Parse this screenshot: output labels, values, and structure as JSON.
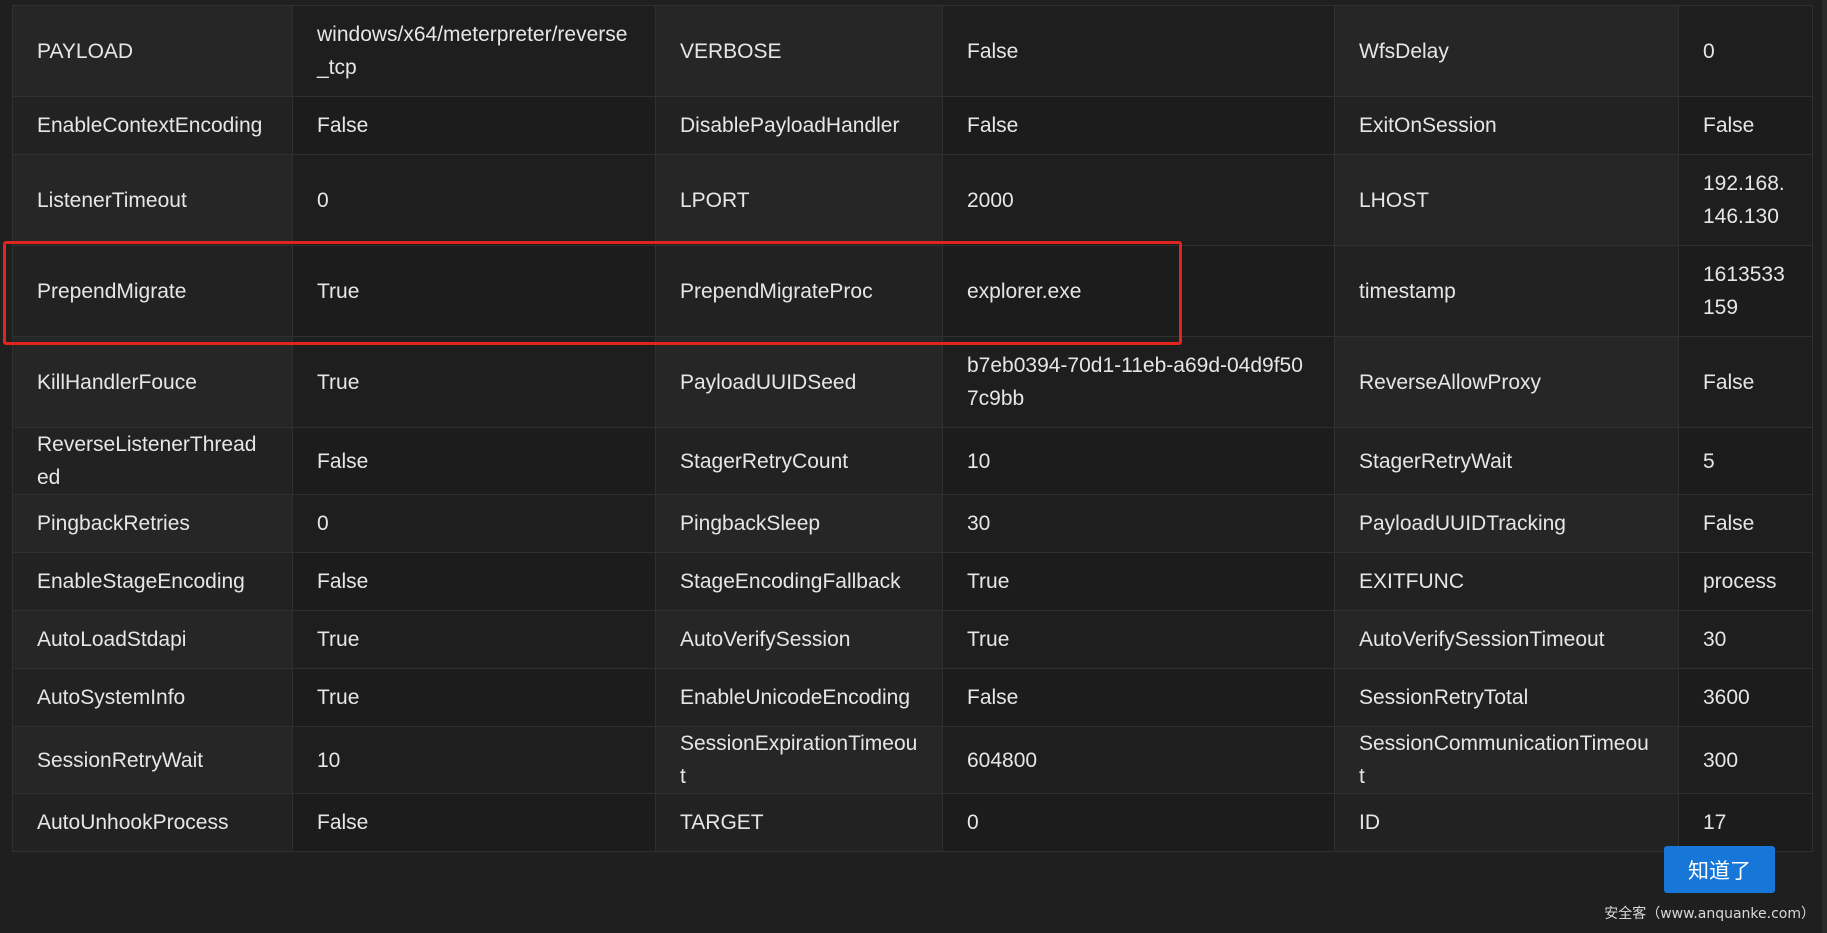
{
  "params": [
    [
      [
        "PAYLOAD",
        "windows/x64/meterpreter/reverse_tcp"
      ],
      [
        "VERBOSE",
        "False"
      ],
      [
        "WfsDelay",
        "0"
      ]
    ],
    [
      [
        "EnableContextEncoding",
        "False"
      ],
      [
        "DisablePayloadHandler",
        "False"
      ],
      [
        "ExitOnSession",
        "False"
      ]
    ],
    [
      [
        "ListenerTimeout",
        "0"
      ],
      [
        "LPORT",
        "2000"
      ],
      [
        "LHOST",
        "192.168.146.130"
      ]
    ],
    [
      [
        "PrependMigrate",
        "True"
      ],
      [
        "PrependMigrateProc",
        "explorer.exe"
      ],
      [
        "timestamp",
        "1613533159"
      ]
    ],
    [
      [
        "KillHandlerFouce",
        "True"
      ],
      [
        "PayloadUUIDSeed",
        "b7eb0394-70d1-11eb-a69d-04d9f507c9bb"
      ],
      [
        "ReverseAllowProxy",
        "False"
      ]
    ],
    [
      [
        "ReverseListenerThreaded",
        "False"
      ],
      [
        "StagerRetryCount",
        "10"
      ],
      [
        "StagerRetryWait",
        "5"
      ]
    ],
    [
      [
        "PingbackRetries",
        "0"
      ],
      [
        "PingbackSleep",
        "30"
      ],
      [
        "PayloadUUIDTracking",
        "False"
      ]
    ],
    [
      [
        "EnableStageEncoding",
        "False"
      ],
      [
        "StageEncodingFallback",
        "True"
      ],
      [
        "EXITFUNC",
        "process"
      ]
    ],
    [
      [
        "AutoLoadStdapi",
        "True"
      ],
      [
        "AutoVerifySession",
        "True"
      ],
      [
        "AutoVerifySessionTimeout",
        "30"
      ]
    ],
    [
      [
        "AutoSystemInfo",
        "True"
      ],
      [
        "EnableUnicodeEncoding",
        "False"
      ],
      [
        "SessionRetryTotal",
        "3600"
      ]
    ],
    [
      [
        "SessionRetryWait",
        "10"
      ],
      [
        "SessionExpirationTimeout",
        "604800"
      ],
      [
        "SessionCommunicationTimeout",
        "300"
      ]
    ],
    [
      [
        "AutoUnhookProcess",
        "False"
      ],
      [
        "TARGET",
        "0"
      ],
      [
        "ID",
        "17"
      ]
    ]
  ],
  "ok_button": "知道了",
  "watermark": "安全客（www.anquanke.com）",
  "colors": {
    "highlight": "#e0251f",
    "button": "#1677d9",
    "background": "#1f1f1f"
  }
}
